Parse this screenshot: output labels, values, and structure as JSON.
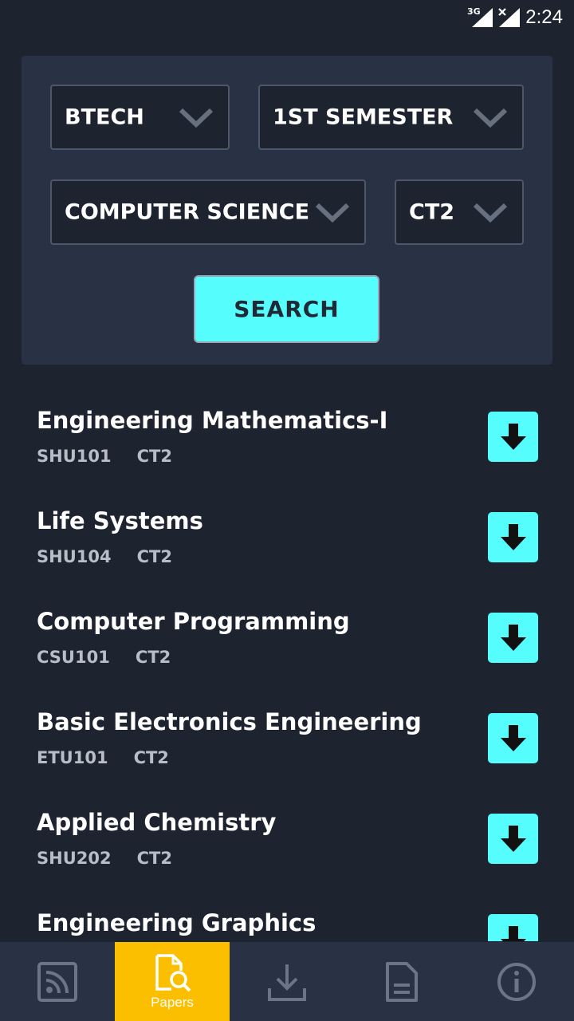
{
  "status_bar": {
    "network": "3G",
    "time": "2:24"
  },
  "filters": {
    "course": "BTECH",
    "semester": "1ST SEMESTER",
    "branch": "COMPUTER SCIENCE",
    "exam": "CT2",
    "search_label": "SEARCH"
  },
  "papers": [
    {
      "title": "Engineering Mathematics-I",
      "code": "SHU101",
      "exam": "CT2"
    },
    {
      "title": "Life Systems",
      "code": "SHU104",
      "exam": "CT2"
    },
    {
      "title": "Computer Programming",
      "code": "CSU101",
      "exam": "CT2"
    },
    {
      "title": "Basic Electronics Engineering",
      "code": "ETU101",
      "exam": "CT2"
    },
    {
      "title": "Applied Chemistry",
      "code": "SHU202",
      "exam": "CT2"
    },
    {
      "title": "Engineering Graphics",
      "code": "",
      "exam": ""
    }
  ],
  "bottom_nav": {
    "items": [
      {
        "icon": "feed-icon",
        "label": ""
      },
      {
        "icon": "papers-icon",
        "label": "Papers",
        "active": true
      },
      {
        "icon": "download-icon",
        "label": ""
      },
      {
        "icon": "document-icon",
        "label": ""
      },
      {
        "icon": "info-icon",
        "label": ""
      }
    ]
  },
  "colors": {
    "background": "#1e2330",
    "card": "#283244",
    "accent_cyan": "#56fdfd",
    "active_nav": "#fbbf00",
    "muted_text": "#b8bec7"
  }
}
